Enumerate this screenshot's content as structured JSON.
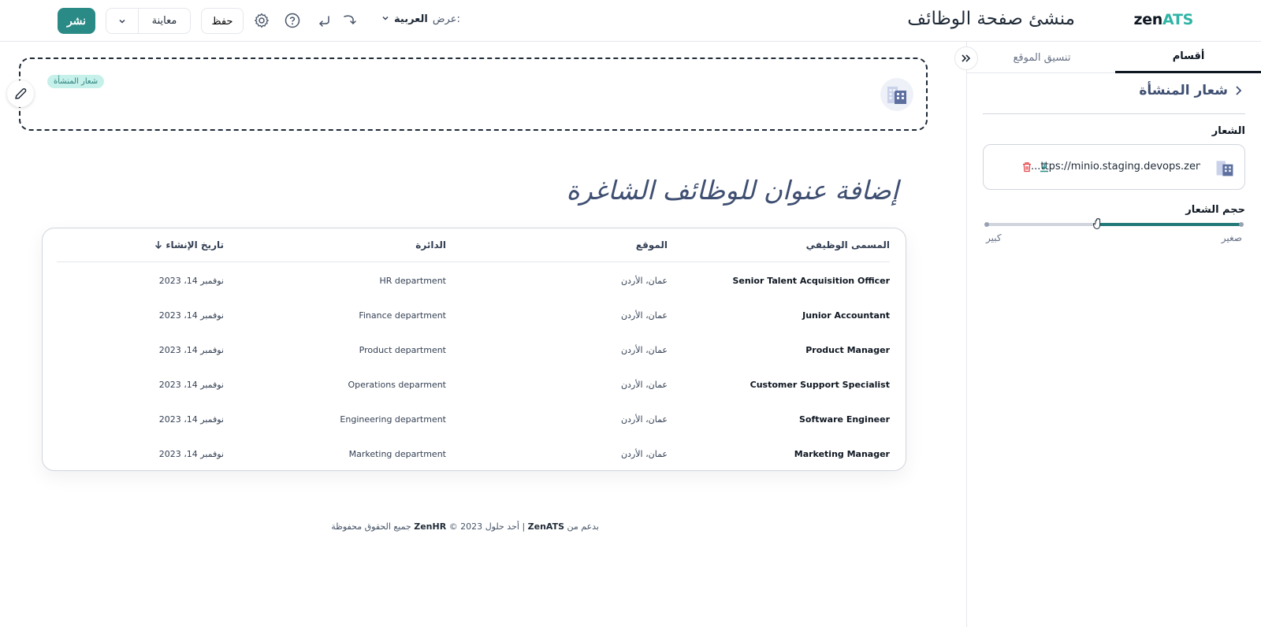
{
  "header": {
    "brand_zen": "zen",
    "brand_ats": "ATS",
    "app_title": "منشئ صفحة الوظائف",
    "publish_label": "نشر",
    "preview_label": "معاينة",
    "save_label": "حفظ",
    "view_prefix": "عرض:",
    "view_value": "العربية"
  },
  "panel": {
    "tabs": [
      {
        "label": "أقسام",
        "active": true
      },
      {
        "label": "تنسيق الموقع",
        "active": false
      }
    ],
    "section_title": "شعار المنشأة",
    "logo_label": "الشعار",
    "logo_url": "...ttps://minio.staging.devops.zenh",
    "size_label": "حجم الشعار",
    "size_small": "صغير",
    "size_large": "كبير",
    "size_value_fraction": 0.56
  },
  "main": {
    "logo_tag": "شعار المنشأة",
    "jobs_heading": "إضافة عنوان للوظائف الشاغرة",
    "table": {
      "headers": {
        "title": "المسمى الوظيفي",
        "location": "الموقع",
        "department": "الدائرة",
        "created": "تاريخ الإنشاء"
      },
      "rows": [
        {
          "title": "Senior Talent Acquisition Officer",
          "location": "عمان، الأردن",
          "department": "HR department",
          "created": "نوفمبر 14، 2023"
        },
        {
          "title": "Junior Accountant",
          "location": "عمان، الأردن",
          "department": "Finance department",
          "created": "نوفمبر 14، 2023"
        },
        {
          "title": "Product Manager",
          "location": "عمان، الأردن",
          "department": "Product department",
          "created": "نوفمبر 14، 2023"
        },
        {
          "title": "Customer Support Specialist",
          "location": "عمان، الأردن",
          "department": "Operations deparment",
          "created": "نوفمبر 14، 2023"
        },
        {
          "title": "Software Engineer",
          "location": "عمان، الأردن",
          "department": "Engineering department",
          "created": "نوفمبر 14، 2023"
        },
        {
          "title": "Marketing Manager",
          "location": "عمان، الأردن",
          "department": "Marketing department",
          "created": "نوفمبر 14، 2023"
        }
      ]
    },
    "footer": {
      "powered_by": "بدعم من",
      "product": "ZenATS",
      "separator": "|",
      "one_of": "أحد حلول",
      "company": "ZenHR",
      "rights": "© 2023 جميع الحقوق محفوظة"
    }
  },
  "colors": {
    "accent": "#2a8a86",
    "brand_ats": "#2fb4a6",
    "heading": "#3f4f72",
    "danger": "#e5484d"
  }
}
